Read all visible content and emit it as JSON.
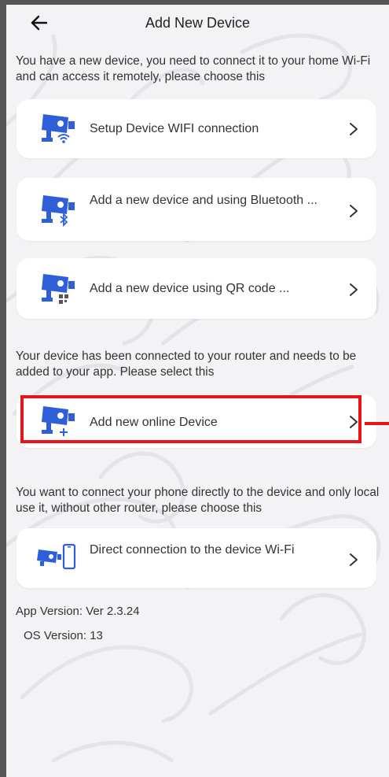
{
  "header": {
    "title": "Add New Device",
    "back_icon": "back-arrow-icon"
  },
  "sections": [
    {
      "description": "You have a new device, you need to connect it to your home Wi-Fi and can access it remotely, please choose this",
      "items": [
        {
          "label": "Setup Device WIFI connection",
          "icon": "camera-wifi-icon"
        },
        {
          "label": "Add a new device and using Bluetooth ...",
          "icon": "camera-bluetooth-icon"
        },
        {
          "label": "Add a new device using QR code ...",
          "icon": "camera-qr-icon"
        }
      ]
    },
    {
      "description": "Your device has been connected to your router and needs to be added to your app. Please select this",
      "items": [
        {
          "label": "Add new online Device",
          "icon": "camera-add-icon"
        }
      ]
    },
    {
      "description": "You want to connect your phone directly to the device and only local use it, without other router, please choose this",
      "items": [
        {
          "label": "Direct connection to the device Wi-Fi",
          "icon": "camera-phone-icon"
        }
      ]
    }
  ],
  "footer": {
    "app_version": "App Version: Ver 2.3.24",
    "os_version": "OS Version: 13"
  },
  "colors": {
    "accent": "#2f5fd8",
    "highlight": "#e8141b",
    "background": "#f3f3f5",
    "card": "#ffffff"
  }
}
